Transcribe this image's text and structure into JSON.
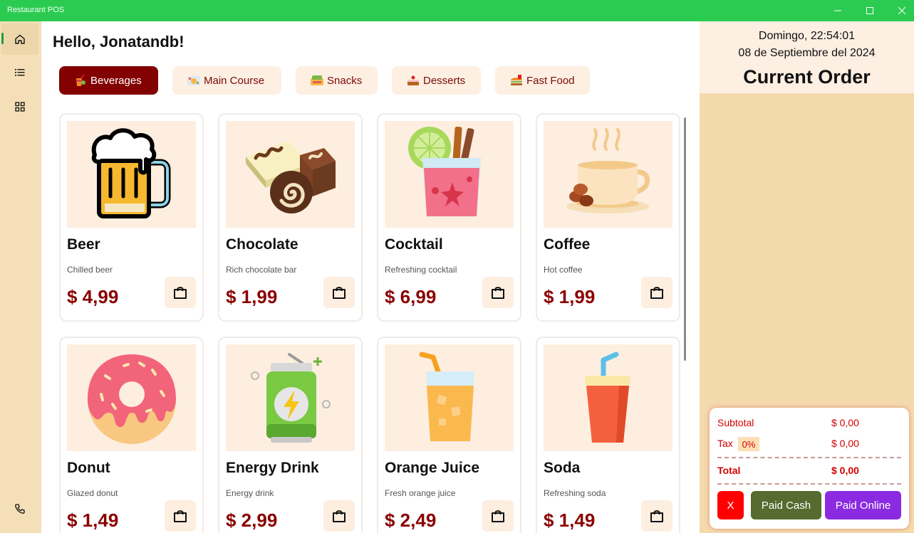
{
  "window": {
    "title": "Restaurant POS"
  },
  "greeting": "Hello, Jonatandb!",
  "categories": [
    {
      "label": "Beverages",
      "active": true
    },
    {
      "label": "Main Course",
      "active": false
    },
    {
      "label": "Snacks",
      "active": false
    },
    {
      "label": "Desserts",
      "active": false
    },
    {
      "label": "Fast Food",
      "active": false
    }
  ],
  "products": [
    {
      "name": "Beer",
      "description": "Chilled beer",
      "price": "$ 4,99",
      "icon": "beer-mug-icon"
    },
    {
      "name": "Chocolate",
      "description": "Rich chocolate bar",
      "price": "$ 1,99",
      "icon": "chocolate-icon"
    },
    {
      "name": "Cocktail",
      "description": "Refreshing cocktail",
      "price": "$ 6,99",
      "icon": "cocktail-icon"
    },
    {
      "name": "Coffee",
      "description": "Hot coffee",
      "price": "$ 1,99",
      "icon": "coffee-cup-icon"
    },
    {
      "name": "Donut",
      "description": "Glazed donut",
      "price": "$ 1,49",
      "icon": "donut-icon"
    },
    {
      "name": "Energy Drink",
      "description": "Energy drink",
      "price": "$ 2,99",
      "icon": "energy-can-icon"
    },
    {
      "name": "Orange Juice",
      "description": "Fresh orange juice",
      "price": "$ 2,49",
      "icon": "orange-juice-icon"
    },
    {
      "name": "Soda",
      "description": "Refreshing soda",
      "price": "$ 1,49",
      "icon": "soda-cup-icon"
    }
  ],
  "order": {
    "datetime_line1": "Domingo, 22:54:01",
    "datetime_line2": "08 de Septiembre del 2024",
    "title": "Current Order",
    "subtotal_label": "Subtotal",
    "subtotal_value": "$ 0,00",
    "tax_label": "Tax",
    "tax_rate": "0%",
    "tax_value": "$ 0,00",
    "total_label": "Total",
    "total_value": "$ 0,00",
    "clear_label": "X",
    "paid_cash_label": "Paid Cash",
    "paid_online_label": "Paid Online"
  },
  "colors": {
    "titlebar": "#2bcb52",
    "accent": "#820000",
    "sidebar": "#f4dfb8",
    "order_panel": "#f4d9ad",
    "clear_button": "#ff0000",
    "paid_cash_button": "#556b2f",
    "paid_online_button": "#8a2be2"
  }
}
